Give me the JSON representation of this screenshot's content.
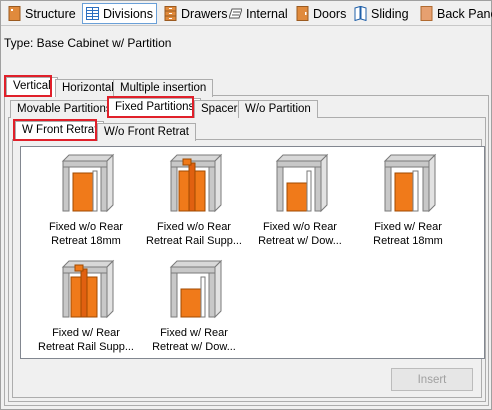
{
  "toolbar": {
    "tabs": [
      {
        "label": "Structure",
        "icon": "structure-icon"
      },
      {
        "label": "Divisions",
        "icon": "divisions-icon"
      },
      {
        "label": "Drawers",
        "icon": "drawers-icon"
      },
      {
        "label": "Internal",
        "icon": "internal-icon"
      },
      {
        "label": "Doors",
        "icon": "doors-icon"
      },
      {
        "label": "Sliding",
        "icon": "sliding-icon"
      },
      {
        "label": "Back Panel",
        "icon": "back-panel-icon"
      }
    ],
    "active": "Divisions"
  },
  "type_line": "Type: Base Cabinet w/ Partition",
  "level1_tabs": [
    "Vertical",
    "Horizontal",
    "Multiple insertion"
  ],
  "level2_tabs": [
    "Movable Partitions",
    "Fixed Partitions",
    "Spacer",
    "W/o Partition"
  ],
  "level3_tabs": [
    "W Front Retrat",
    "W/o Front Retrat"
  ],
  "items": [
    {
      "line1": "Fixed w/o Rear",
      "line2": "Retreat 18mm"
    },
    {
      "line1": "Fixed w/o Rear",
      "line2": "Retreat Rail Supp..."
    },
    {
      "line1": "Fixed w/o Rear",
      "line2": "Retreat w/ Dow..."
    },
    {
      "line1": "Fixed w/ Rear",
      "line2": "Retreat 18mm"
    },
    {
      "line1": "Fixed w/ Rear",
      "line2": "Retreat Rail Supp..."
    },
    {
      "line1": "Fixed w/ Rear",
      "line2": "Retreat w/ Dow..."
    }
  ],
  "insert_button": "Insert",
  "colors": {
    "accent_orange": "#f07a1a",
    "highlight_red": "#e0202a",
    "cabinet_grey": "#c8c8c8"
  }
}
